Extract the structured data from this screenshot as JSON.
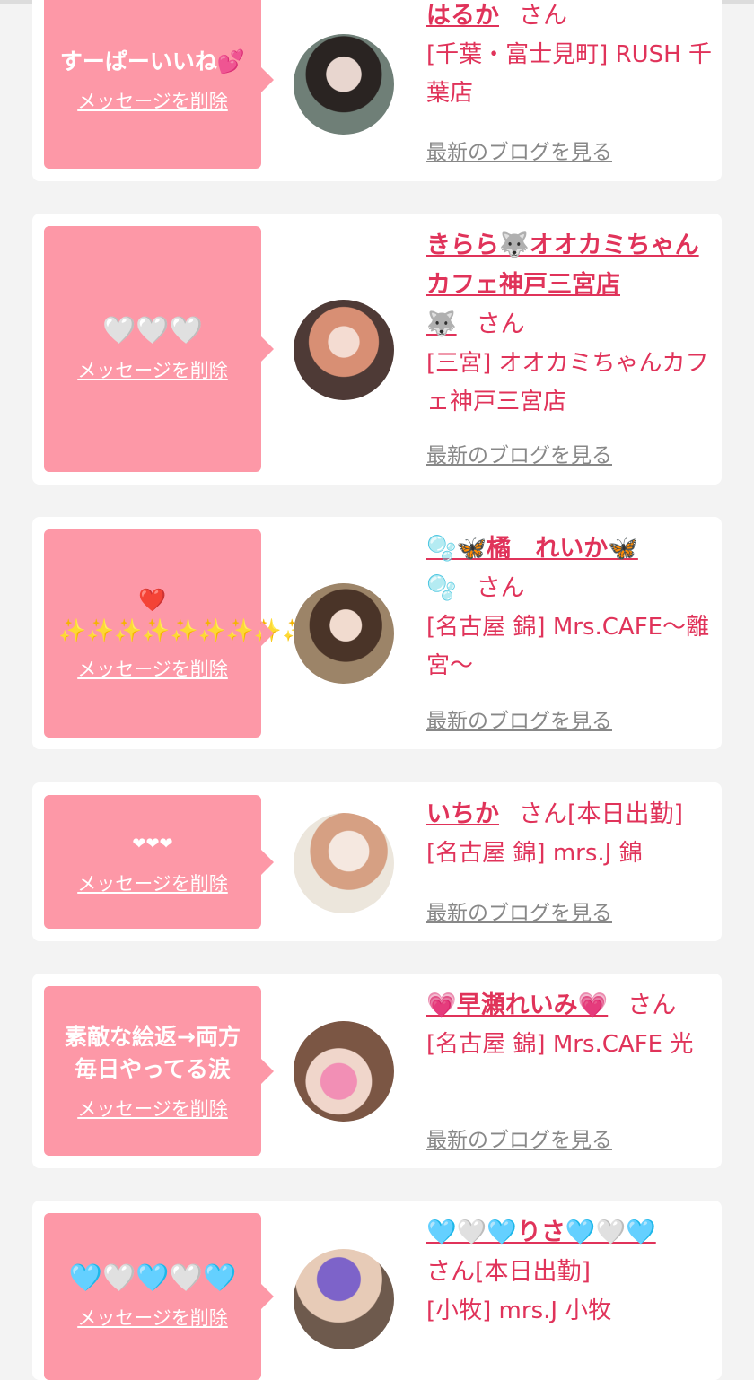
{
  "colors": {
    "accent": "#e0335a",
    "bubble": "#fd98a7",
    "page_bg": "#f3f3f3",
    "link_gray": "#888888"
  },
  "common": {
    "delete_label": "メッセージを削除",
    "blog_label": "最新のブログを見る",
    "honorific": "さん"
  },
  "cards": [
    {
      "message": "すーぱーいいね💕",
      "name": "はるか",
      "name_extra": "",
      "status": "",
      "shop": "[千葉・富士見町] RUSH 千葉店"
    },
    {
      "message": "🤍🤍🤍",
      "name": "きらら🐺オオカミちゃんカフェ神戸三宮店",
      "name_extra": "🐺",
      "status": "",
      "shop": "[三宮] オオカミちゃんカフェ神戸三宮店"
    },
    {
      "message": "❤️ ✨✨✨✨✨✨✨✨✨✨",
      "name": "🫧🦋橘　れいか🦋",
      "name_extra": "🫧",
      "status": "",
      "shop": "[名古屋 錦] Mrs.CAFE〜離宮〜"
    },
    {
      "message": "❤❤❤",
      "name": "いちか",
      "name_extra": "",
      "status": "[本日出勤]",
      "shop": "[名古屋 錦] mrs.J 錦"
    },
    {
      "message": "素敵な絵返→両方毎日やってる涙",
      "name": "💗早瀬れいみ💗",
      "name_extra": "",
      "status": "",
      "shop": "[名古屋 錦] Mrs.CAFE 光"
    },
    {
      "message": "🩵🤍🩵🤍🩵",
      "name": "🩵🤍🩵りさ🩵🤍🩵",
      "name_extra": "",
      "status": "[本日出勤]",
      "shop": "[小牧] mrs.J 小牧"
    }
  ]
}
